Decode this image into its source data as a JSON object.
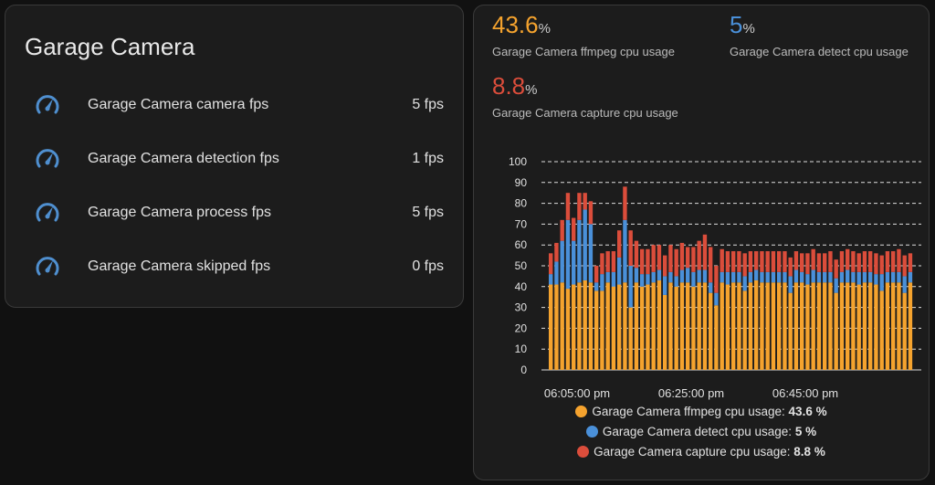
{
  "entities_card": {
    "title": "Garage Camera",
    "rows": [
      {
        "label": "Garage Camera camera fps",
        "value": "5 fps",
        "icon": "speedometer-icon"
      },
      {
        "label": "Garage Camera detection fps",
        "value": "1 fps",
        "icon": "speedometer-icon"
      },
      {
        "label": "Garage Camera process fps",
        "value": "5 fps",
        "icon": "speedometer-icon"
      },
      {
        "label": "Garage Camera skipped fps",
        "value": "0 fps",
        "icon": "speedometer-icon"
      }
    ]
  },
  "stats": [
    {
      "value": "43.6",
      "unit": "%",
      "name": "Garage Camera ffmpeg cpu usage",
      "color": "#f5a32e"
    },
    {
      "value": "5",
      "unit": "%",
      "name": "Garage Camera detect cpu usage",
      "color": "#4a90d9"
    },
    {
      "value": "8.8",
      "unit": "%",
      "name": "Garage Camera capture cpu usage",
      "color": "#db4d3b"
    }
  ],
  "chart_data": {
    "type": "bar",
    "stacked": true,
    "ylim": [
      0,
      100
    ],
    "yticks": [
      0,
      10,
      20,
      30,
      40,
      50,
      60,
      70,
      80,
      90,
      100
    ],
    "xticks": [
      "06:05:00 pm",
      "06:25:00 pm",
      "06:45:00 pm"
    ],
    "grid": true,
    "legend_placement": "bottom",
    "series": [
      {
        "name": "Garage Camera ffmpeg cpu usage",
        "legend_value": "43.6 %",
        "color": "#f5a32e",
        "values": [
          41,
          41,
          42,
          39,
          41,
          42,
          43,
          42,
          38,
          38,
          42,
          40,
          41,
          42,
          30,
          42,
          40,
          41,
          42,
          43,
          36,
          42,
          40,
          42,
          42,
          40,
          42,
          42,
          37,
          31,
          42,
          41,
          42,
          42,
          38,
          42,
          43,
          42,
          42,
          42,
          42,
          42,
          37,
          42,
          42,
          41,
          42,
          42,
          42,
          42,
          37,
          42,
          42,
          42,
          41,
          42,
          42,
          41,
          38,
          42,
          42,
          42,
          37,
          42
        ]
      },
      {
        "name": "Garage Camera detect cpu usage",
        "legend_value": "5 %",
        "color": "#4a90d9",
        "values": [
          5,
          11,
          20,
          33,
          21,
          30,
          34,
          28,
          4,
          8,
          5,
          7,
          13,
          30,
          20,
          7,
          6,
          5,
          5,
          5,
          9,
          5,
          5,
          6,
          7,
          7,
          6,
          6,
          5,
          6,
          5,
          6,
          5,
          5,
          7,
          5,
          5,
          5,
          5,
          5,
          5,
          5,
          8,
          6,
          5,
          5,
          6,
          5,
          5,
          5,
          7,
          5,
          6,
          5,
          6,
          5,
          5,
          5,
          8,
          5,
          5,
          5,
          8,
          5
        ]
      },
      {
        "name": "Garage Camera capture cpu usage",
        "legend_value": "8.8 %",
        "color": "#db4d3b",
        "values": [
          10,
          9,
          10,
          13,
          11,
          13,
          8,
          11,
          8,
          10,
          10,
          10,
          13,
          16,
          17,
          13,
          12,
          12,
          13,
          12,
          10,
          13,
          13,
          13,
          10,
          12,
          14,
          17,
          17,
          13,
          11,
          10,
          10,
          10,
          11,
          10,
          9,
          10,
          10,
          10,
          10,
          10,
          9,
          9,
          9,
          10,
          10,
          9,
          9,
          10,
          9,
          10,
          10,
          10,
          9,
          10,
          10,
          10,
          9,
          10,
          10,
          11,
          10,
          9
        ]
      }
    ]
  }
}
